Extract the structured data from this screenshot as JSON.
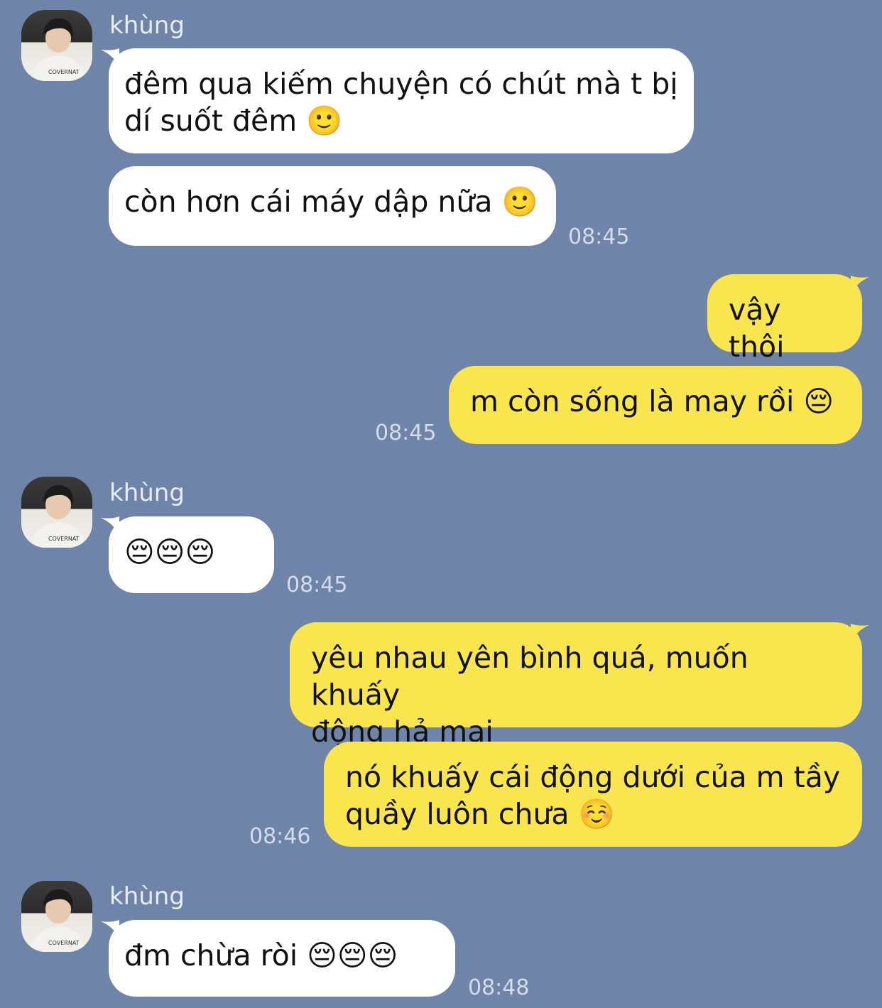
{
  "contact": {
    "name": "khùng",
    "avatar_caption": "COVERNAT"
  },
  "colors": {
    "background": "#6e84a8",
    "incoming": "#ffffff",
    "outgoing": "#f9e54e"
  },
  "messages": [
    {
      "from": "contact",
      "text": "đêm qua kiếm chuyện có chút mà t bị\ndí suốt đêm 🙂"
    },
    {
      "from": "contact",
      "text": "còn hơn cái máy dập nữa 🙂",
      "time": "08:45"
    },
    {
      "from": "me",
      "text": "vậy thôi"
    },
    {
      "from": "me",
      "text": "m còn sống là may rồi 😔",
      "time": "08:45"
    },
    {
      "from": "contact",
      "text": "😔😔😔",
      "time": "08:45"
    },
    {
      "from": "me",
      "text": "yêu nhau yên bình quá, muốn khuấy\nđộng hả mại"
    },
    {
      "from": "me",
      "text": "nó khuấy cái động dưới của m tầy\nquầy luôn chưa ☺️",
      "time": "08:46"
    },
    {
      "from": "contact",
      "text": "đm chừa ròi 😔😔😔",
      "time": "08:48"
    }
  ]
}
